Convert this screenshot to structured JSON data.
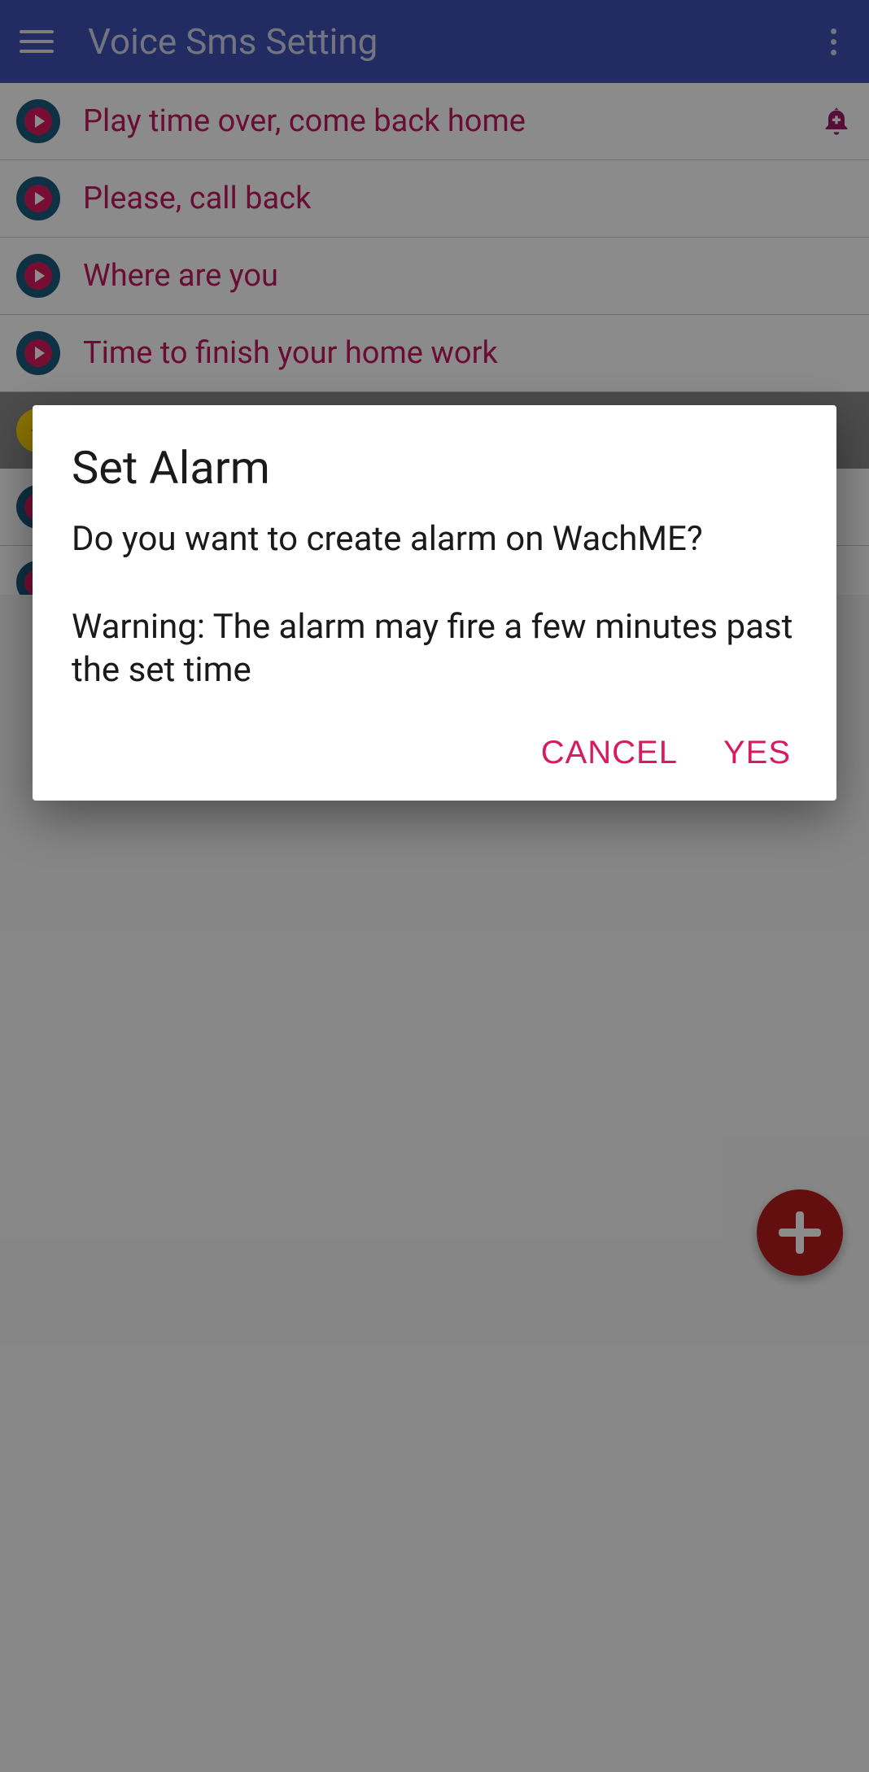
{
  "appbar": {
    "title": "Voice Sms Setting"
  },
  "messages": [
    {
      "text": "Play time over, come back home",
      "has_bell": true
    },
    {
      "text": "Please, call back",
      "has_bell": false
    },
    {
      "text": "Where are you",
      "has_bell": false
    },
    {
      "text": "Time to finish your home work",
      "has_bell": false
    }
  ],
  "dialog": {
    "title": "Set Alarm",
    "body": "Do you want to create alarm on WachME?\n\nWarning: The alarm may fire a few minutes past the set time",
    "cancel": "CANCEL",
    "confirm": "YES"
  }
}
